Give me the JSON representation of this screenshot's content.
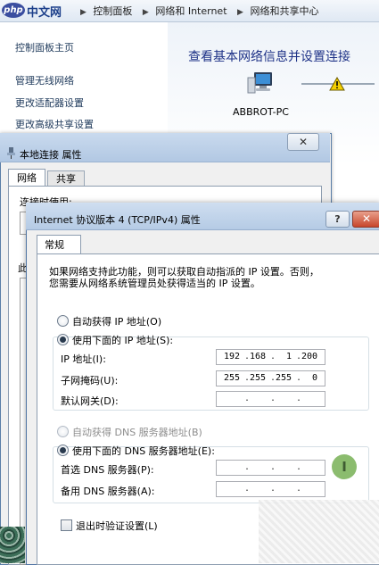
{
  "control_panel": {
    "logo_text": "php",
    "logo_cn": "中文网",
    "breadcrumb": [
      "控制面板",
      "网络和 Internet",
      "网络和共享中心"
    ],
    "sidebar": [
      "控制面板主页",
      "管理无线网络",
      "更改适配器设置",
      "更改高级共享设置"
    ],
    "title": "查看基本网络信息并设置连接",
    "computer_name": "ABBROT-PC"
  },
  "lan_dialog": {
    "title": "本地连接 属性",
    "close_symbol": "✕",
    "tabs": [
      "网络",
      "共享"
    ],
    "connect_using_label": "连接时使用:",
    "this_connection_label": "此"
  },
  "ipv4_dialog": {
    "title": "Internet 协议版本 4 (TCP/IPv4) 属性",
    "help_symbol": "?",
    "close_symbol": "✕",
    "tab": "常规",
    "description_line1": "如果网络支持此功能，则可以获取自动指派的 IP 设置。否则，",
    "description_line2": "您需要从网络系统管理员处获得适当的 IP 设置。",
    "ip_auto_label": "自动获得 IP 地址(O)",
    "ip_manual_label": "使用下面的 IP 地址(S):",
    "ip_mode": "manual",
    "ip_address_label": "IP 地址(I):",
    "subnet_label": "子网掩码(U):",
    "gateway_label": "默认网关(D):",
    "ip_address": [
      "192",
      "168",
      "1",
      "200"
    ],
    "subnet_mask": [
      "255",
      "255",
      "255",
      "0"
    ],
    "gateway": [
      "",
      "",
      "",
      ""
    ],
    "dns_auto_label": "自动获得 DNS 服务器地址(B)",
    "dns_manual_label": "使用下面的 DNS 服务器地址(E):",
    "dns_mode": "manual",
    "preferred_dns_label": "首选 DNS 服务器(P):",
    "alternate_dns_label": "备用 DNS 服务器(A):",
    "preferred_dns": [
      "",
      "",
      "",
      ""
    ],
    "alternate_dns": [
      "",
      "",
      "",
      ""
    ],
    "validate_on_exit_label": "退出时验证设置(L)",
    "validate_on_exit": false,
    "cursor_symbol": "I"
  }
}
